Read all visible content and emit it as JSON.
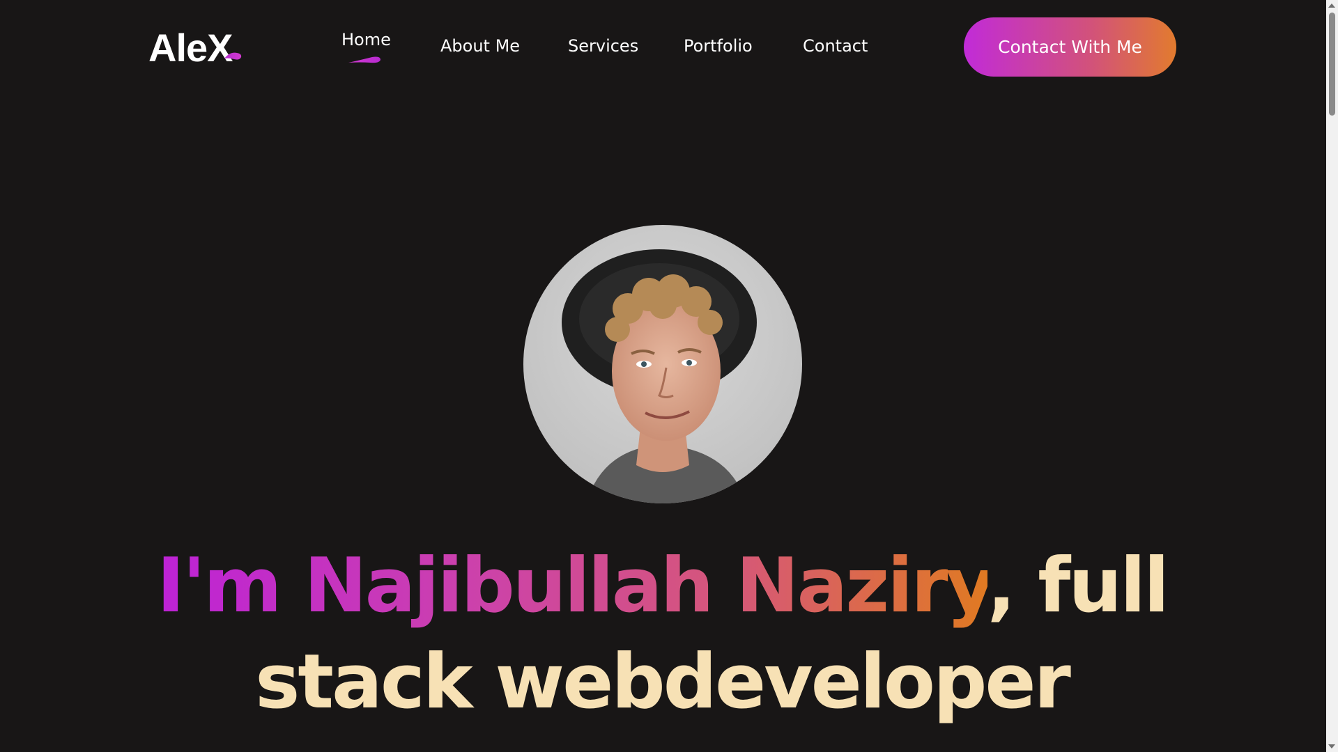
{
  "brand": {
    "logo_text": "AleX"
  },
  "nav": {
    "items": [
      {
        "label": "Home",
        "active": true
      },
      {
        "label": "About Me"
      },
      {
        "label": "Services"
      },
      {
        "label": "Portfolio"
      },
      {
        "label": "Contact"
      }
    ]
  },
  "cta": {
    "label": "Contact With Me"
  },
  "hero": {
    "avatar_icon": "profile-photo",
    "headline_gradient": "I'm Najibullah Naziry",
    "headline_comma": ",",
    "headline_rest_line1": "full",
    "headline_line2": "stack webdeveloper"
  },
  "colors": {
    "background": "#181616",
    "accent_purple": "#c12bd8",
    "accent_orange": "#e27b2e",
    "headline_cream": "#f7e1b5"
  }
}
